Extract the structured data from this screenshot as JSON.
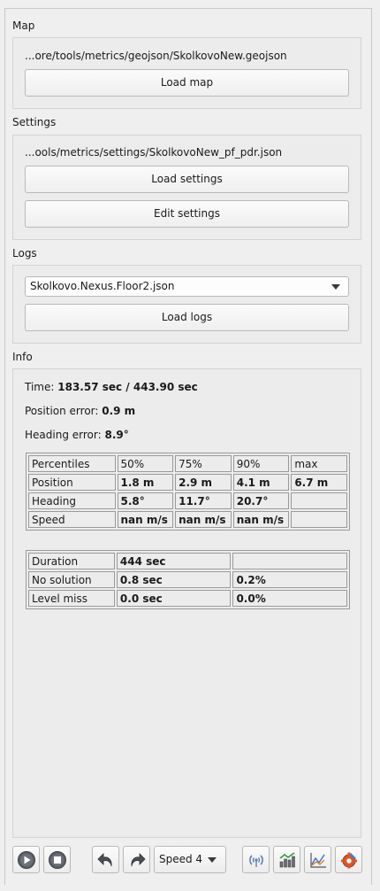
{
  "map": {
    "section_label": "Map",
    "path": "...ore/tools/metrics/geojson/SkolkovoNew.geojson",
    "load_button": "Load map"
  },
  "settings": {
    "section_label": "Settings",
    "path": "...ools/metrics/settings/SkolkovoNew_pf_pdr.json",
    "load_button": "Load settings",
    "edit_button": "Edit settings"
  },
  "logs": {
    "section_label": "Logs",
    "selected_log": "Skolkovo.Nexus.Floor2.json",
    "load_button": "Load logs"
  },
  "info": {
    "section_label": "Info",
    "time_label": "Time:",
    "time_value": "183.57 sec / 443.90 sec",
    "position_error_label": "Position error:",
    "position_error_value": "0.9 m",
    "heading_error_label": "Heading error:",
    "heading_error_value": "8.9°",
    "percentiles": {
      "headers": [
        "Percentiles",
        "50%",
        "75%",
        "90%",
        "max"
      ],
      "rows": [
        [
          "Position",
          "1.8 m",
          "2.9 m",
          "4.1 m",
          "6.7 m"
        ],
        [
          "Heading",
          "5.8°",
          "11.7°",
          "20.7°",
          ""
        ],
        [
          "Speed",
          "nan m/s",
          "nan m/s",
          "nan m/s",
          ""
        ]
      ]
    },
    "summary": {
      "rows": [
        [
          "Duration",
          "444 sec",
          ""
        ],
        [
          "No solution",
          "0.8 sec",
          "0.2%"
        ],
        [
          "Level miss",
          "0.0 sec",
          "0.0%"
        ]
      ]
    }
  },
  "toolbar": {
    "speed_value": "Speed 4",
    "icons": [
      "play-icon",
      "stop-icon",
      "undo-icon",
      "redo-icon",
      "signal-icon",
      "bar-chart-icon",
      "line-chart-icon",
      "settings-icon"
    ]
  }
}
